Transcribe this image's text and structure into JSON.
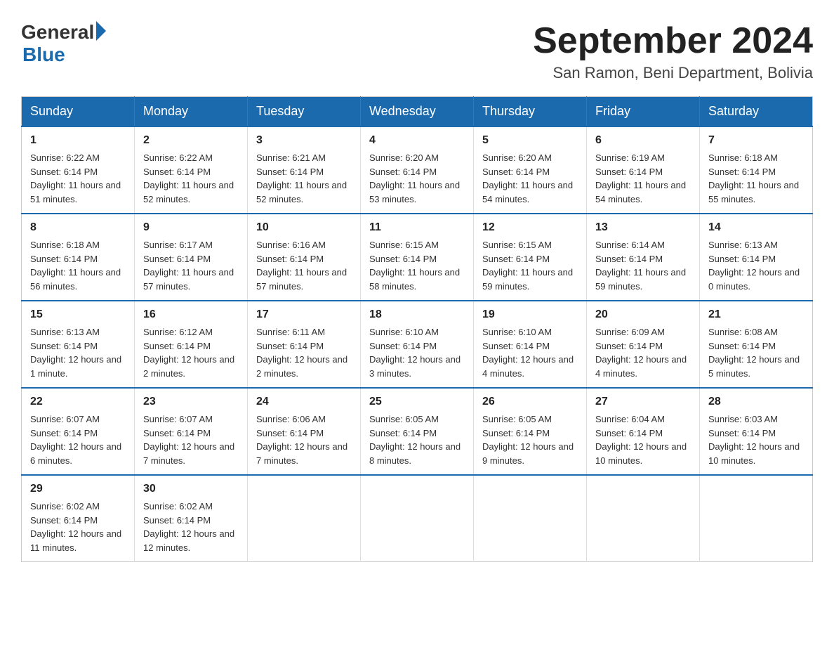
{
  "logo": {
    "text_general": "General",
    "text_blue": "Blue"
  },
  "title": {
    "month_year": "September 2024",
    "location": "San Ramon, Beni Department, Bolivia"
  },
  "days_of_week": [
    "Sunday",
    "Monday",
    "Tuesday",
    "Wednesday",
    "Thursday",
    "Friday",
    "Saturday"
  ],
  "weeks": [
    [
      {
        "day": "1",
        "sunrise": "6:22 AM",
        "sunset": "6:14 PM",
        "daylight": "11 hours and 51 minutes."
      },
      {
        "day": "2",
        "sunrise": "6:22 AM",
        "sunset": "6:14 PM",
        "daylight": "11 hours and 52 minutes."
      },
      {
        "day": "3",
        "sunrise": "6:21 AM",
        "sunset": "6:14 PM",
        "daylight": "11 hours and 52 minutes."
      },
      {
        "day": "4",
        "sunrise": "6:20 AM",
        "sunset": "6:14 PM",
        "daylight": "11 hours and 53 minutes."
      },
      {
        "day": "5",
        "sunrise": "6:20 AM",
        "sunset": "6:14 PM",
        "daylight": "11 hours and 54 minutes."
      },
      {
        "day": "6",
        "sunrise": "6:19 AM",
        "sunset": "6:14 PM",
        "daylight": "11 hours and 54 minutes."
      },
      {
        "day": "7",
        "sunrise": "6:18 AM",
        "sunset": "6:14 PM",
        "daylight": "11 hours and 55 minutes."
      }
    ],
    [
      {
        "day": "8",
        "sunrise": "6:18 AM",
        "sunset": "6:14 PM",
        "daylight": "11 hours and 56 minutes."
      },
      {
        "day": "9",
        "sunrise": "6:17 AM",
        "sunset": "6:14 PM",
        "daylight": "11 hours and 57 minutes."
      },
      {
        "day": "10",
        "sunrise": "6:16 AM",
        "sunset": "6:14 PM",
        "daylight": "11 hours and 57 minutes."
      },
      {
        "day": "11",
        "sunrise": "6:15 AM",
        "sunset": "6:14 PM",
        "daylight": "11 hours and 58 minutes."
      },
      {
        "day": "12",
        "sunrise": "6:15 AM",
        "sunset": "6:14 PM",
        "daylight": "11 hours and 59 minutes."
      },
      {
        "day": "13",
        "sunrise": "6:14 AM",
        "sunset": "6:14 PM",
        "daylight": "11 hours and 59 minutes."
      },
      {
        "day": "14",
        "sunrise": "6:13 AM",
        "sunset": "6:14 PM",
        "daylight": "12 hours and 0 minutes."
      }
    ],
    [
      {
        "day": "15",
        "sunrise": "6:13 AM",
        "sunset": "6:14 PM",
        "daylight": "12 hours and 1 minute."
      },
      {
        "day": "16",
        "sunrise": "6:12 AM",
        "sunset": "6:14 PM",
        "daylight": "12 hours and 2 minutes."
      },
      {
        "day": "17",
        "sunrise": "6:11 AM",
        "sunset": "6:14 PM",
        "daylight": "12 hours and 2 minutes."
      },
      {
        "day": "18",
        "sunrise": "6:10 AM",
        "sunset": "6:14 PM",
        "daylight": "12 hours and 3 minutes."
      },
      {
        "day": "19",
        "sunrise": "6:10 AM",
        "sunset": "6:14 PM",
        "daylight": "12 hours and 4 minutes."
      },
      {
        "day": "20",
        "sunrise": "6:09 AM",
        "sunset": "6:14 PM",
        "daylight": "12 hours and 4 minutes."
      },
      {
        "day": "21",
        "sunrise": "6:08 AM",
        "sunset": "6:14 PM",
        "daylight": "12 hours and 5 minutes."
      }
    ],
    [
      {
        "day": "22",
        "sunrise": "6:07 AM",
        "sunset": "6:14 PM",
        "daylight": "12 hours and 6 minutes."
      },
      {
        "day": "23",
        "sunrise": "6:07 AM",
        "sunset": "6:14 PM",
        "daylight": "12 hours and 7 minutes."
      },
      {
        "day": "24",
        "sunrise": "6:06 AM",
        "sunset": "6:14 PM",
        "daylight": "12 hours and 7 minutes."
      },
      {
        "day": "25",
        "sunrise": "6:05 AM",
        "sunset": "6:14 PM",
        "daylight": "12 hours and 8 minutes."
      },
      {
        "day": "26",
        "sunrise": "6:05 AM",
        "sunset": "6:14 PM",
        "daylight": "12 hours and 9 minutes."
      },
      {
        "day": "27",
        "sunrise": "6:04 AM",
        "sunset": "6:14 PM",
        "daylight": "12 hours and 10 minutes."
      },
      {
        "day": "28",
        "sunrise": "6:03 AM",
        "sunset": "6:14 PM",
        "daylight": "12 hours and 10 minutes."
      }
    ],
    [
      {
        "day": "29",
        "sunrise": "6:02 AM",
        "sunset": "6:14 PM",
        "daylight": "12 hours and 11 minutes."
      },
      {
        "day": "30",
        "sunrise": "6:02 AM",
        "sunset": "6:14 PM",
        "daylight": "12 hours and 12 minutes."
      },
      null,
      null,
      null,
      null,
      null
    ]
  ],
  "labels": {
    "sunrise": "Sunrise:",
    "sunset": "Sunset:",
    "daylight": "Daylight:"
  }
}
